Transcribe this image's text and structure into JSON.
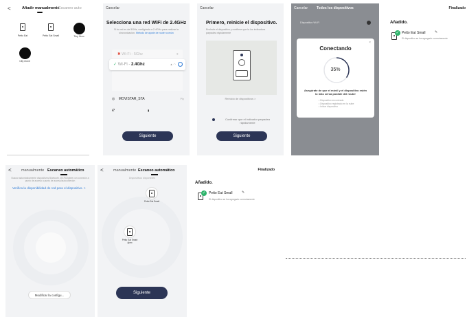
{
  "p1": {
    "back": "<",
    "tab_manual": "Añadir manualmente",
    "tab_auto": "Escaneo auto",
    "devices": [
      {
        "label": "Petto Eat"
      },
      {
        "label": "Petto Eat Small"
      },
      {
        "label": "Tiny Guro"
      },
      {
        "label": "City move"
      }
    ]
  },
  "p2": {
    "cancel": "Cancelar",
    "title": "Selecciona una red WiFi de 2.4GHz",
    "desc": "Si tu red es de 5GHz, configúrala a 2.4GHz para realizar la sincronización.",
    "link": "Método de ajuste de router común",
    "wifi_5g": "Wi-Fi - 5Ghz",
    "wifi_24g_prefix": "Wi-Fi - ",
    "wifi_24g_bold": "2.4Ghz",
    "network": "MOVISTAR_STA",
    "network_action": "Ply",
    "button": "Siguiente"
  },
  "p3": {
    "cancel": "Cancelar",
    "title": "Primero, reinicie el dispositivo.",
    "desc": "Enchufe el dispositivo y confirme que la luz indicadora parpadea rápidamente",
    "reset_link": "Reinicio de dispositivos >",
    "confirm": "Confirmar que el indicador parpadea rápidamente",
    "button": "Siguiente"
  },
  "p4": {
    "cancel": "Cancelar",
    "title": "Todos los dispositivos",
    "bg_row": "Dispositivo Wi-Fi",
    "modal_title": "Conectando",
    "progress": 35,
    "progress_label": "35%",
    "modal_msg": "Asegúrate de que el móvil y el dispositivo estén lo más cerca posible del router",
    "steps": [
      "Dispositivo encontrado",
      "Dispositivo registrado en la nube",
      "Iniciar dispositivo"
    ]
  },
  "p5": {
    "finish": "Finalizado",
    "added": "Añadido.",
    "device_name": "Petto Eat Small",
    "device_status": "El dispositivo se ha agregado correctamente"
  },
  "p6": {
    "back": "<",
    "tab_manual": "manualmente",
    "tab_auto": "Escaneo automático",
    "notice": "Buscar automáticamente dispositivos Bluetooth, Wi-Fi/Zigbee con conexión a punto de acceso a punto de acceso/autoconexión",
    "verify": "Verifica la disponibilidad de red para el dispositivo. >",
    "button": "Modificar la configu..."
  },
  "p7": {
    "back": "<",
    "tab_manual": "manualmente",
    "tab_auto": "Escaneo automático",
    "found": "Dispositivos disponibles",
    "dev1": "Petto Eat Small",
    "dev2": "Petto Eat Smart Apex",
    "button": "Siguiente"
  },
  "p8": {
    "finish": "Finalizado",
    "added": "Añadido.",
    "device_name": "Petto Eat Small",
    "device_status": "El dispositivo se ha agregado correctamente"
  },
  "colors": {
    "accent_blue": "#2e7bd6",
    "button_dark": "#2c3556",
    "success_green": "#2db36a",
    "error_red": "#e04a3a"
  }
}
